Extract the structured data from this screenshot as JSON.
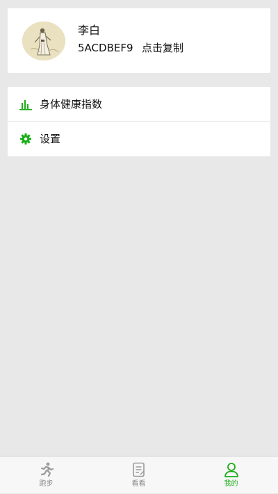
{
  "profile": {
    "name": "李白",
    "id": "5ACDBEF9",
    "copy_label": "点击复制",
    "avatar": "avatar-portrait"
  },
  "menu": {
    "items": [
      {
        "label": "身体健康指数",
        "icon": "bar-chart-icon"
      },
      {
        "label": "设置",
        "icon": "gear-icon"
      }
    ]
  },
  "tabbar": {
    "tabs": [
      {
        "label": "跑步",
        "icon": "running-icon",
        "active": false
      },
      {
        "label": "看看",
        "icon": "note-icon",
        "active": false
      },
      {
        "label": "我的",
        "icon": "person-icon",
        "active": true
      }
    ]
  },
  "colors": {
    "accent": "#1aad19",
    "tab_inactive": "#8a8a8a",
    "background": "#e8e8e8",
    "card": "#ffffff"
  }
}
